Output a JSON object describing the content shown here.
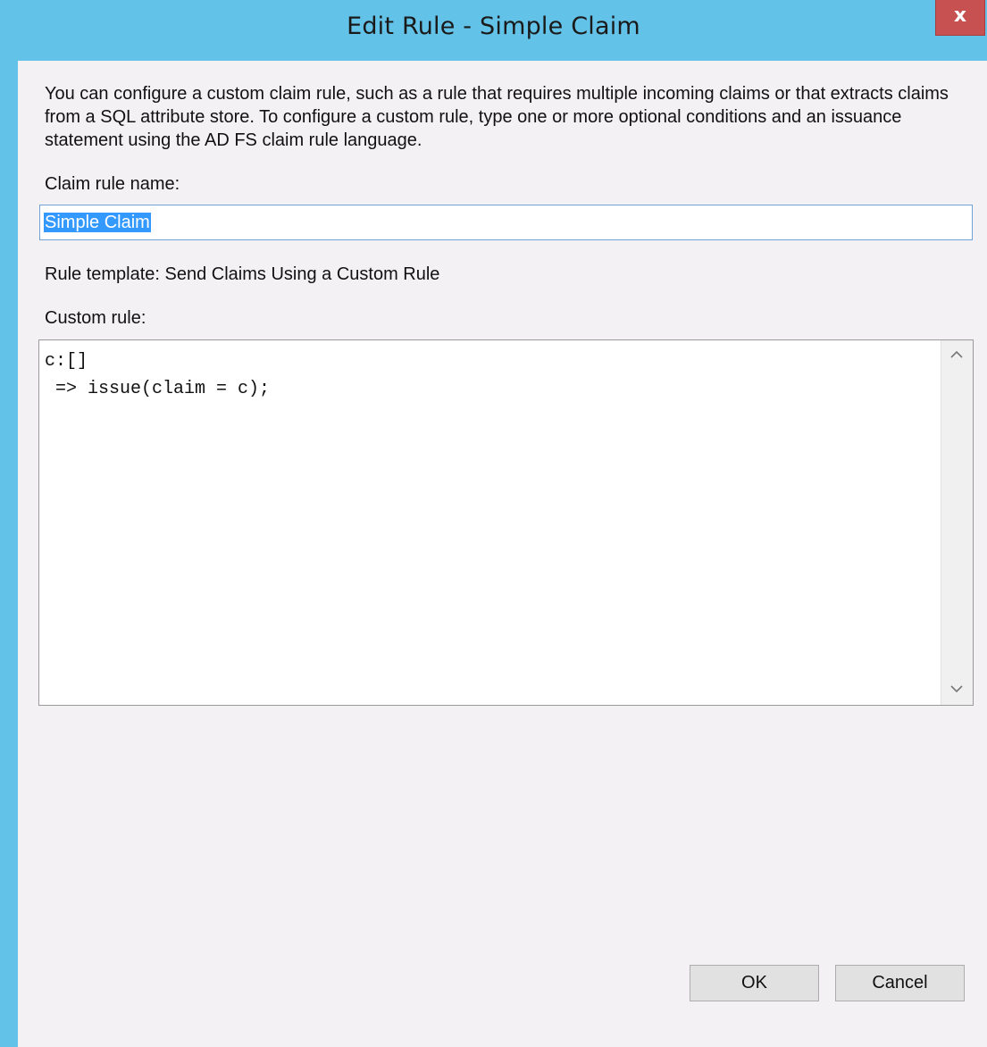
{
  "window": {
    "title": "Edit Rule - Simple Claim",
    "close_glyph": "x"
  },
  "description": "You can configure a custom claim rule, such as a rule that requires multiple incoming claims or that extracts claims from a SQL attribute store. To configure a custom rule, type one or more optional conditions and an issuance statement using the AD FS claim rule language.",
  "claim_rule_name": {
    "label": "Claim rule name:",
    "value": "Simple Claim"
  },
  "rule_template": "Rule template: Send Claims Using a Custom Rule",
  "custom_rule": {
    "label": "Custom rule:",
    "value": "c:[]\n => issue(claim = c);"
  },
  "buttons": {
    "ok": "OK",
    "cancel": "Cancel"
  },
  "colors": {
    "titlebar": "#63c2e8",
    "close": "#c75050",
    "client": "#f4f1f5",
    "selection": "#3399ff"
  },
  "icons": {
    "close": "close-icon",
    "scroll_up": "chevron-up-icon",
    "scroll_down": "chevron-down-icon"
  }
}
